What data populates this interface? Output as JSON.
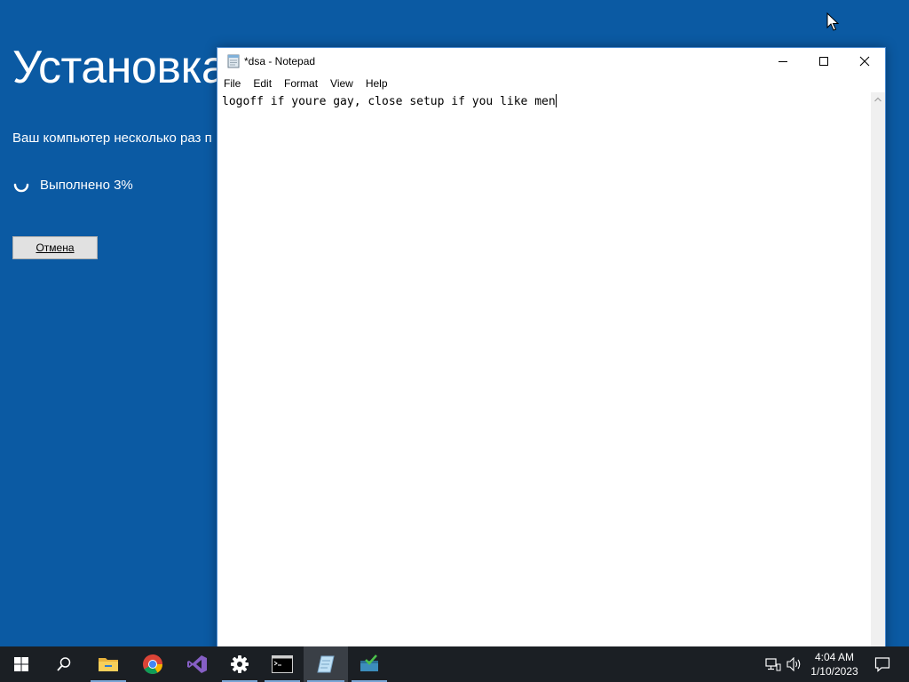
{
  "setup": {
    "title": "Установка",
    "message": "Ваш компьютер несколько раз п",
    "progress": "Выполнено 3%",
    "cancel_label": "Отмена"
  },
  "notepad": {
    "title": "*dsa - Notepad",
    "menu": [
      "File",
      "Edit",
      "Format",
      "View",
      "Help"
    ],
    "content": "logoff if youre gay, close setup if you like men"
  },
  "taskbar": {
    "apps": [
      "start-icon",
      "search-icon",
      "file-explorer-icon",
      "chrome-icon",
      "visual-studio-icon",
      "settings-icon",
      "command-prompt-icon",
      "notepad-icon",
      "task-scheduler-icon"
    ],
    "time": "4:04 AM",
    "date": "1/10/2023"
  },
  "colors": {
    "setup_bg": "#0b5aa3",
    "taskbar_bg": "#1b1f24",
    "window_border": "#4a8ad0"
  }
}
